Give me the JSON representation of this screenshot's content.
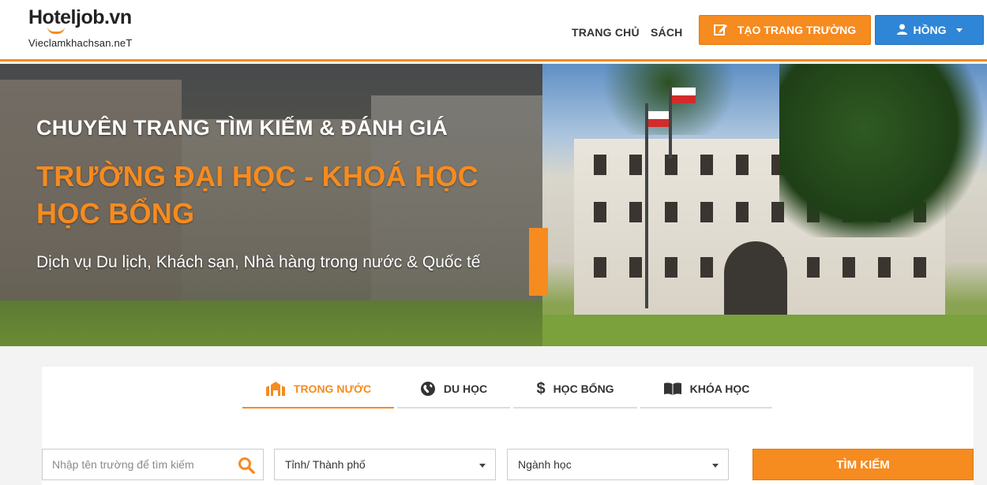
{
  "brand": {
    "logo_text": "Hoteljob.vn",
    "sub_text": "Vieclamkhachsan.neT",
    "accent_color": "#f68b1f"
  },
  "nav": {
    "home": "TRANG CHỦ",
    "book": "SÁCH",
    "create_button": "TẠO TRANG TRƯỜNG",
    "create_icon": "edit-icon",
    "user_button": "HỒNG",
    "user_icon": "user-icon",
    "user_button_color": "#2f86d6"
  },
  "hero": {
    "title": "CHUYÊN TRANG TÌM KIẾM & ĐÁNH GIÁ",
    "headline_line1": "TRƯỜNG ĐẠI HỌC - KHOÁ HỌC",
    "headline_line2": "HỌC BỔNG",
    "subtitle": "Dịch vụ Du lịch, Khách sạn, Nhà hàng trong nước & Quốc tế"
  },
  "tabs": [
    {
      "label": "TRONG NƯỚC",
      "icon": "university-icon",
      "active": true
    },
    {
      "label": "DU HỌC",
      "icon": "globe-icon",
      "active": false
    },
    {
      "label": "HỌC BỔNG",
      "icon": "dollar-icon",
      "active": false
    },
    {
      "label": "KHÓA HỌC",
      "icon": "book-icon",
      "active": false
    }
  ],
  "search": {
    "placeholder": "Nhập tên trường để tìm kiếm",
    "value": "",
    "city_select": "Tỉnh/ Thành phố",
    "major_select": "Ngành học",
    "button": "TÌM KIẾM"
  }
}
